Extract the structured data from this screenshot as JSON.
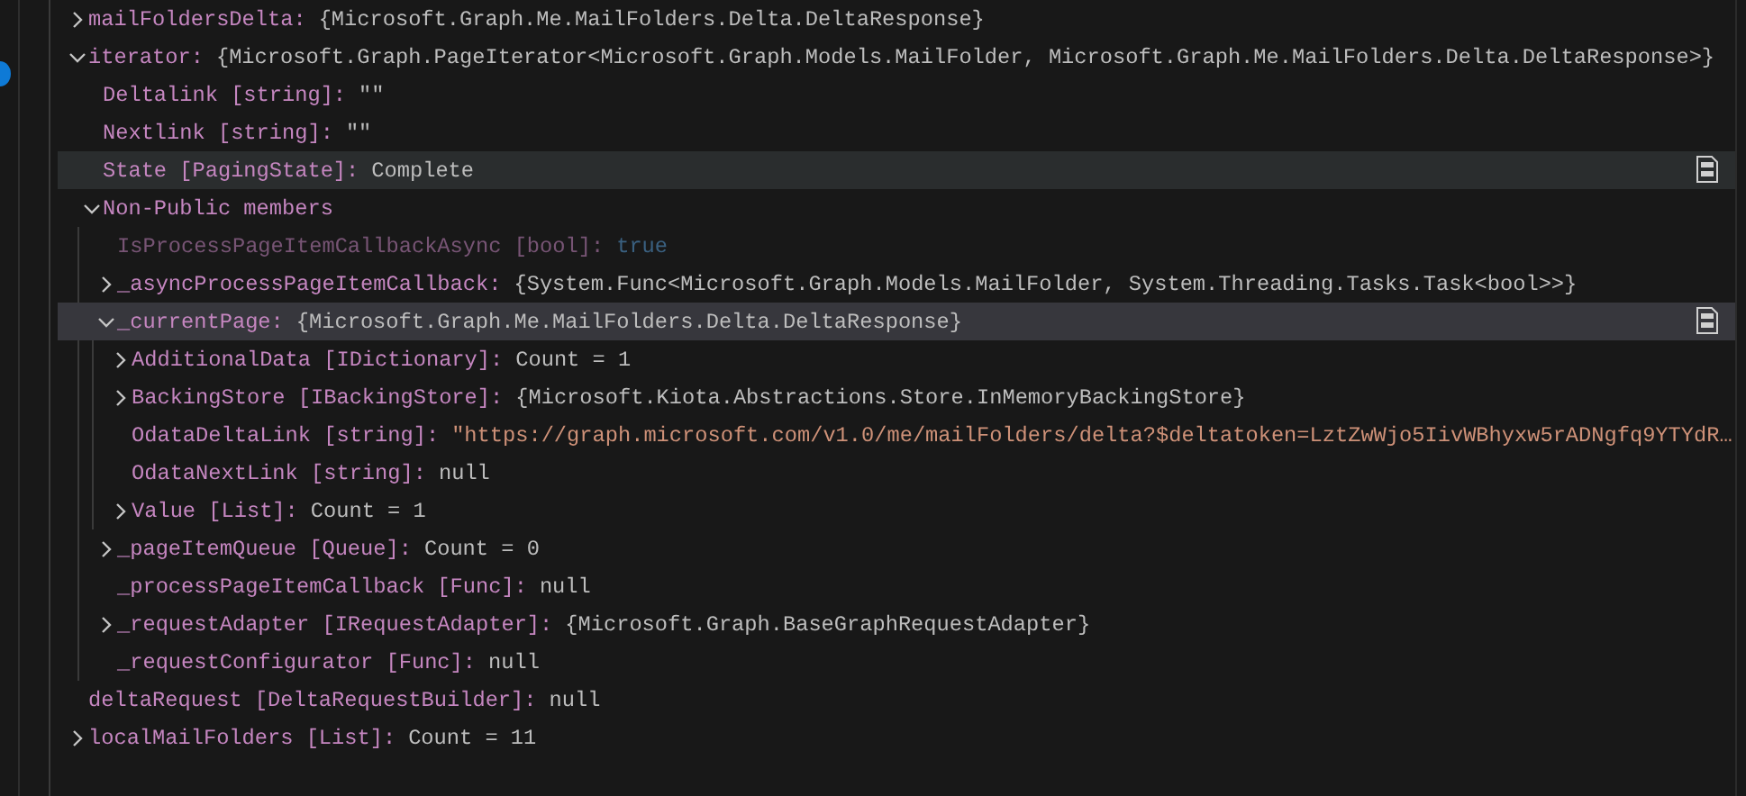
{
  "variables": [
    {
      "kind": "group",
      "expanded": false,
      "label": "mailFoldersDelta:",
      "value": {
        "kind": "plain",
        "text": "{Microsoft.Graph.Me.MailFolders.Delta.DeltaResponse}"
      }
    },
    {
      "kind": "group",
      "expanded": true,
      "label": "iterator:",
      "value": {
        "kind": "plain",
        "text": "{Microsoft.Graph.PageIterator<Microsoft.Graph.Models.MailFolder, Microsoft.Graph.Me.MailFolders.Delta.DeltaResponse>}"
      },
      "children": [
        {
          "kind": "leaf",
          "label": "Deltalink [string]:",
          "value": {
            "kind": "plain",
            "text": "\"\""
          }
        },
        {
          "kind": "leaf",
          "label": "Nextlink [string]:",
          "value": {
            "kind": "plain",
            "text": "\"\""
          }
        },
        {
          "kind": "leaf",
          "label": "State [PagingState]:",
          "value": {
            "kind": "plain",
            "text": "Complete"
          },
          "hovered": true
        },
        {
          "kind": "group",
          "expanded": true,
          "label": "Non-Public members",
          "children": [
            {
              "kind": "leaf",
              "label": "IsProcessPageItemCallbackAsync [bool]:",
              "value": {
                "kind": "bool",
                "text": "true"
              },
              "dimmed": true
            },
            {
              "kind": "group",
              "expanded": false,
              "label": "_asyncProcessPageItemCallback:",
              "value": {
                "kind": "plain",
                "text": "{System.Func<Microsoft.Graph.Models.MailFolder, System.Threading.Tasks.Task<bool>>}"
              }
            },
            {
              "kind": "group",
              "expanded": true,
              "selected": true,
              "label": "_currentPage:",
              "value": {
                "kind": "plain",
                "text": "{Microsoft.Graph.Me.MailFolders.Delta.DeltaResponse}"
              },
              "children": [
                {
                  "kind": "group",
                  "expanded": false,
                  "label": "AdditionalData [IDictionary]:",
                  "value": {
                    "kind": "plain",
                    "text": "Count = 1"
                  }
                },
                {
                  "kind": "group",
                  "expanded": false,
                  "label": "BackingStore [IBackingStore]:",
                  "value": {
                    "kind": "plain",
                    "text": "{Microsoft.Kiota.Abstractions.Store.InMemoryBackingStore}"
                  }
                },
                {
                  "kind": "leaf",
                  "label": "OdataDeltaLink [string]:",
                  "value": {
                    "kind": "string",
                    "text": "\"https://graph.microsoft.com/v1.0/me/mailFolders/delta?$deltatoken=LztZwWjo5IivWBhyxw5rADNgfq9YTYdR…"
                  }
                },
                {
                  "kind": "leaf",
                  "label": "OdataNextLink [string]:",
                  "value": {
                    "kind": "plain",
                    "text": "null"
                  }
                },
                {
                  "kind": "group",
                  "expanded": false,
                  "label": "Value [List]:",
                  "value": {
                    "kind": "plain",
                    "text": "Count = 1"
                  }
                }
              ]
            },
            {
              "kind": "group",
              "expanded": false,
              "label": "_pageItemQueue [Queue]:",
              "value": {
                "kind": "plain",
                "text": "Count = 0"
              }
            },
            {
              "kind": "leaf",
              "label": "_processPageItemCallback [Func]:",
              "value": {
                "kind": "plain",
                "text": "null"
              }
            },
            {
              "kind": "group",
              "expanded": false,
              "label": "_requestAdapter [IRequestAdapter]:",
              "value": {
                "kind": "plain",
                "text": "{Microsoft.Graph.BaseGraphRequestAdapter}"
              }
            },
            {
              "kind": "leaf",
              "label": "_requestConfigurator [Func]:",
              "value": {
                "kind": "plain",
                "text": "null"
              }
            }
          ]
        }
      ]
    },
    {
      "kind": "leaf",
      "label": "deltaRequest [DeltaRequestBuilder]:",
      "value": {
        "kind": "plain",
        "text": "null"
      }
    },
    {
      "kind": "group",
      "expanded": false,
      "label": "localMailFolders [List]:",
      "value": {
        "kind": "plain",
        "text": "Count = 11"
      }
    }
  ]
}
